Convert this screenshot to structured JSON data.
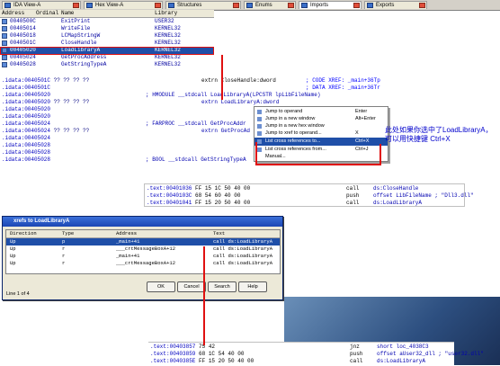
{
  "tabs": [
    {
      "label": "IDA View-A"
    },
    {
      "label": "Hex View-A"
    },
    {
      "label": "Structures"
    },
    {
      "label": "Enums"
    },
    {
      "label": "Imports"
    },
    {
      "label": "Exports"
    }
  ],
  "imports": {
    "headers": [
      "Address",
      "Ordinal",
      "Name",
      "Library"
    ],
    "rows": [
      {
        "address": "0040500C",
        "name": "ExitPrint",
        "library": "USER32"
      },
      {
        "address": "00405014",
        "name": "WriteFile",
        "library": "KERNEL32"
      },
      {
        "address": "00405018",
        "name": "LCMapStringW",
        "library": "KERNEL32"
      },
      {
        "address": "0040501C",
        "name": "CloseHandle",
        "library": "KERNEL32"
      },
      {
        "address": "00405020",
        "name": "LoadLibraryA",
        "library": "KERNEL32"
      },
      {
        "address": "00405024",
        "name": "GetProcAddress",
        "library": "KERNEL32"
      },
      {
        "address": "00405028",
        "name": "GetStringTypeA",
        "library": "KERNEL32"
      }
    ]
  },
  "disasm": [
    {
      "addr": ".idata:0040501C",
      "bytes": "?? ?? ?? ??",
      "code": "extrn CloseHandle:dword",
      "cmt": "; CODE XREF: _main+36Tp"
    },
    {
      "addr": ".idata:0040501C",
      "bytes": "",
      "code": "",
      "cmt": "; DATA XREF: _main+36Tr"
    },
    {
      "addr": ".idata:00405020",
      "bytes": "",
      "code": "; HMODULE __stdcall LoadLibraryA(LPCSTR lpLibFileName)",
      "cmt": ""
    },
    {
      "addr": ".idata:00405020",
      "bytes": "?? ?? ?? ??",
      "code": "extrn LoadLibraryA:dword",
      "cmt": ""
    },
    {
      "addr": ".idata:00405020",
      "bytes": "",
      "code": "",
      "cmt": ""
    },
    {
      "addr": ".idata:00405020",
      "bytes": "",
      "code": "",
      "cmt": ""
    },
    {
      "addr": ".idata:00405024",
      "bytes": "",
      "code": "; FARPROC __stdcall GetProcAddr",
      "cmt": ""
    },
    {
      "addr": ".idata:00405024",
      "bytes": "?? ?? ?? ??",
      "code": "extrn GetProcAd",
      "cmt": ""
    },
    {
      "addr": ".idata:00405024",
      "bytes": "",
      "code": "",
      "cmt": ""
    },
    {
      "addr": ".idata:00405028",
      "bytes": "",
      "code": "",
      "cmt": ""
    },
    {
      "addr": ".idata:00405028",
      "bytes": "",
      "code": "",
      "cmt": ""
    },
    {
      "addr": ".idata:00405028",
      "bytes": "",
      "code": "; BOOL __stdcall GetStringTypeA",
      "cmt": ""
    }
  ],
  "context_menu": [
    {
      "label": "Jump to operand",
      "shortcut": "Enter"
    },
    {
      "label": "Jump in a new window",
      "shortcut": "Alt+Enter"
    },
    {
      "label": "Jump in a new hex window",
      "shortcut": ""
    },
    {
      "label": "Jump to xref to operand...",
      "shortcut": "X"
    },
    {
      "label": "List cross references to...",
      "shortcut": "Ctrl+X"
    },
    {
      "label": "List cross references from...",
      "shortcut": "Ctrl+J"
    },
    {
      "label": "Manual...",
      "shortcut": ""
    }
  ],
  "note": "此处如果你选中了LoadLibraryA，可以用快捷键 Ctrl+X",
  "code2": [
    {
      "addr": ".text:00401036",
      "bytes": "FF 15 1C 50 40 00",
      "mn": "call",
      "op": "ds:CloseHandle"
    },
    {
      "addr": ".text:0040103C",
      "bytes": "68 54 60 40 00",
      "mn": "push",
      "op": "offset LibFileName ; \"Dll3.dll\""
    },
    {
      "addr": ".text:00401041",
      "bytes": "FF 15 20 50 40 00",
      "mn": "call",
      "op": "ds:LoadLibraryA"
    }
  ],
  "xrefs": {
    "title": "xrefs to LoadLibraryA",
    "headers": [
      "Direction",
      "Type",
      "Address",
      "Text"
    ],
    "rows": [
      {
        "dir": "Up",
        "type": "p",
        "address": "_main+41",
        "text": "call    ds:LoadLibraryA"
      },
      {
        "dir": "Up",
        "type": "r",
        "address": "___crtMessageBoxA+12",
        "text": "call    ds:LoadLibraryA"
      },
      {
        "dir": "Up",
        "type": "r",
        "address": "_main+41",
        "text": "call    ds:LoadLibraryA"
      },
      {
        "dir": "Up",
        "type": "r",
        "address": "___crtMessageBoxA+12",
        "text": "call    ds:LoadLibraryA"
      }
    ],
    "status": "Line 1 of 4",
    "buttons": [
      "OK",
      "Cancel",
      "Search",
      "Help"
    ]
  },
  "code3": [
    {
      "addr": ".text:00403857",
      "bytes": "75 42",
      "mn": "jnz",
      "op": "short loc_4038C3"
    },
    {
      "addr": ".text:00403859",
      "bytes": "68 1C 54 40 00",
      "mn": "push",
      "op": "offset aUser32_dll ; \"user32.dll\""
    },
    {
      "addr": ".text:0040385E",
      "bytes": "FF 15 20 50 40 00",
      "mn": "call",
      "op": "ds:LoadLibraryA"
    }
  ],
  "colors": {
    "accent": "#1f4fa8",
    "highlight": "#ffff00",
    "arrow": "#e01010"
  }
}
